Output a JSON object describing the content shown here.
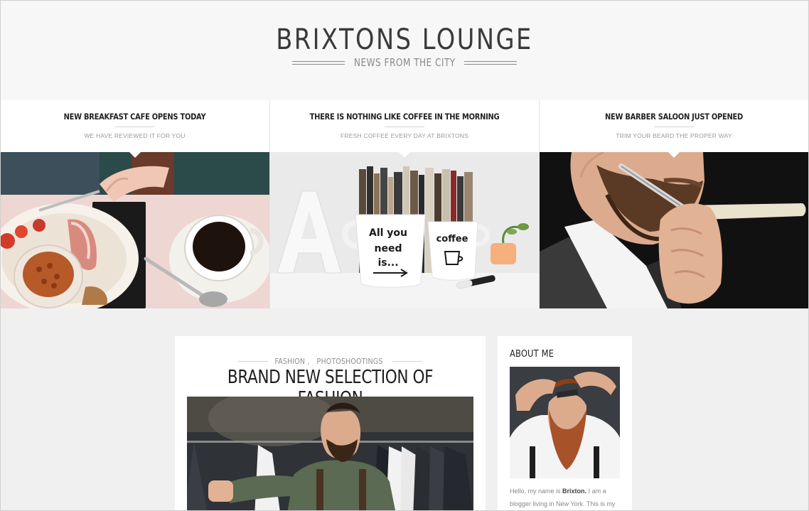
{
  "site": {
    "title": "BRIXTONS LOUNGE",
    "tagline": "NEWS FROM THE CITY"
  },
  "features": [
    {
      "title": "NEW BREAKFAST CAFE OPENS TODAY",
      "subtitle": "WE HAVE REVIEWED IT FOR YOU",
      "image": "breakfast-photo"
    },
    {
      "title": "THERE IS NOTHING LIKE COFFEE IN THE MORNING",
      "subtitle": "FRESH COFFEE EVERY DAY AT BRIXTONS",
      "image": "coffee-mugs-photo",
      "mug_left_text": [
        "All you",
        "need",
        "is..."
      ],
      "mug_right_text": "coffee"
    },
    {
      "title": "NEW BARBER SALOON JUST OPENED",
      "subtitle": "TRIM YOUR BEARD THE PROPER WAY",
      "image": "barber-shave-photo"
    }
  ],
  "post": {
    "categories": [
      "FASHION",
      "PHOTOSHOOTINGS"
    ],
    "category_separator": ",",
    "title": "BRAND NEW SELECTION OF FASHION",
    "image": "fashion-store-photo"
  },
  "about": {
    "heading": "ABOUT ME",
    "image": "bearded-man-portrait",
    "text_intro": "Hello, my name is",
    "name": "Brixton.",
    "text_rest": "I am a",
    "text_line2": "blogger living in New York. This is my"
  },
  "colors": {
    "page_bg": "#f0f0f0",
    "header_bg": "#f7f7f7",
    "card_bg": "#ffffff",
    "title_text": "#3a3a3a",
    "muted_text": "#8a8a8a"
  }
}
